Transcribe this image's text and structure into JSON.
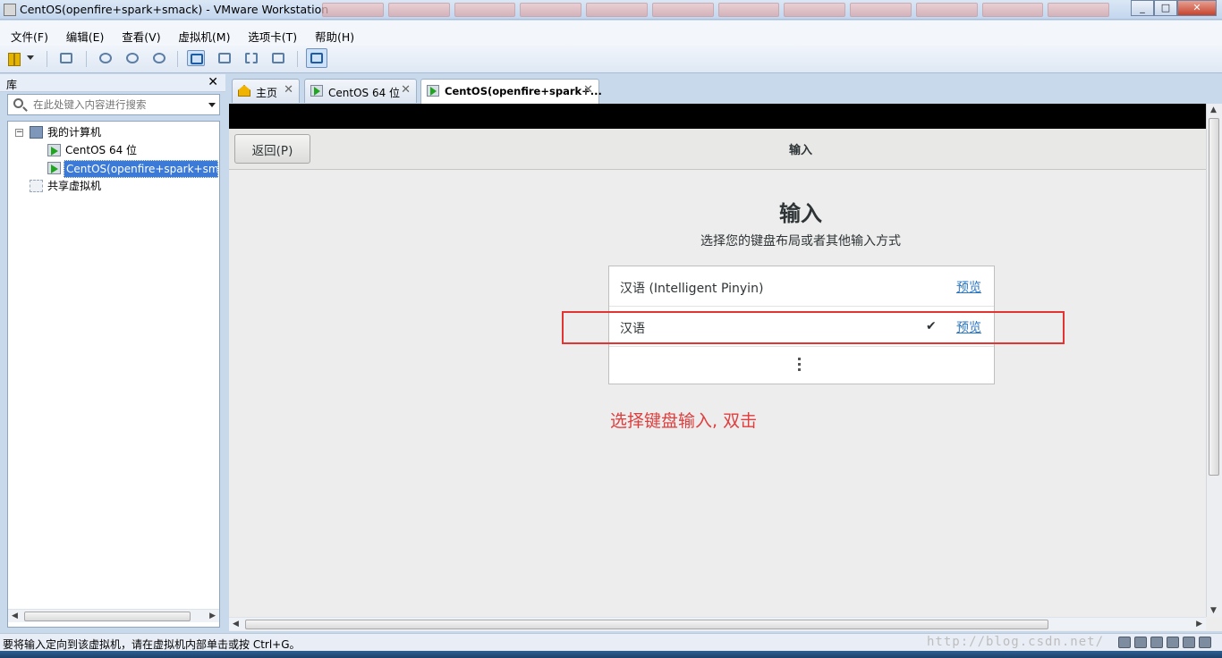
{
  "window": {
    "title": "CentOS(openfire+spark+smack) - VMware Workstation"
  },
  "menu": [
    "文件(F)",
    "编辑(E)",
    "查看(V)",
    "虚拟机(M)",
    "选项卡(T)",
    "帮助(H)"
  ],
  "library": {
    "title": "库",
    "search_placeholder": "在此处键入内容进行搜索",
    "tree": {
      "root": "我的计算机",
      "vms": [
        "CentOS 64 位",
        "CentOS(openfire+spark+smack)"
      ],
      "shared": "共享虚拟机"
    }
  },
  "tabs": [
    {
      "label": "主页",
      "icon": "home-icon"
    },
    {
      "label": "CentOS 64 位",
      "icon": "vm-icon"
    },
    {
      "label": "CentOS(openfire+spark+...",
      "icon": "vm-icon",
      "active": true
    }
  ],
  "guest": {
    "back_button": "返回(P)",
    "header_title": "输入",
    "title": "输入",
    "subtitle": "选择您的键盘布局或者其他输入方式",
    "options": [
      {
        "name": "汉语 (Intelligent Pinyin)",
        "preview": "预览",
        "selected": false
      },
      {
        "name": "汉语",
        "preview": "预览",
        "selected": true,
        "check": "✔"
      }
    ],
    "more_icon": "more-vertical-icon",
    "annotation": "选择键盘输入, 双击",
    "annotation_color": "#e03d3d"
  },
  "status": {
    "text": "要将输入定向到该虚拟机，请在虚拟机内部单击或按 Ctrl+G。",
    "watermark": "http://blog.csdn.net/"
  },
  "colors": {
    "accent": "#3b7ad6",
    "link": "#2a76c6",
    "highlight_box": "#e33434"
  }
}
